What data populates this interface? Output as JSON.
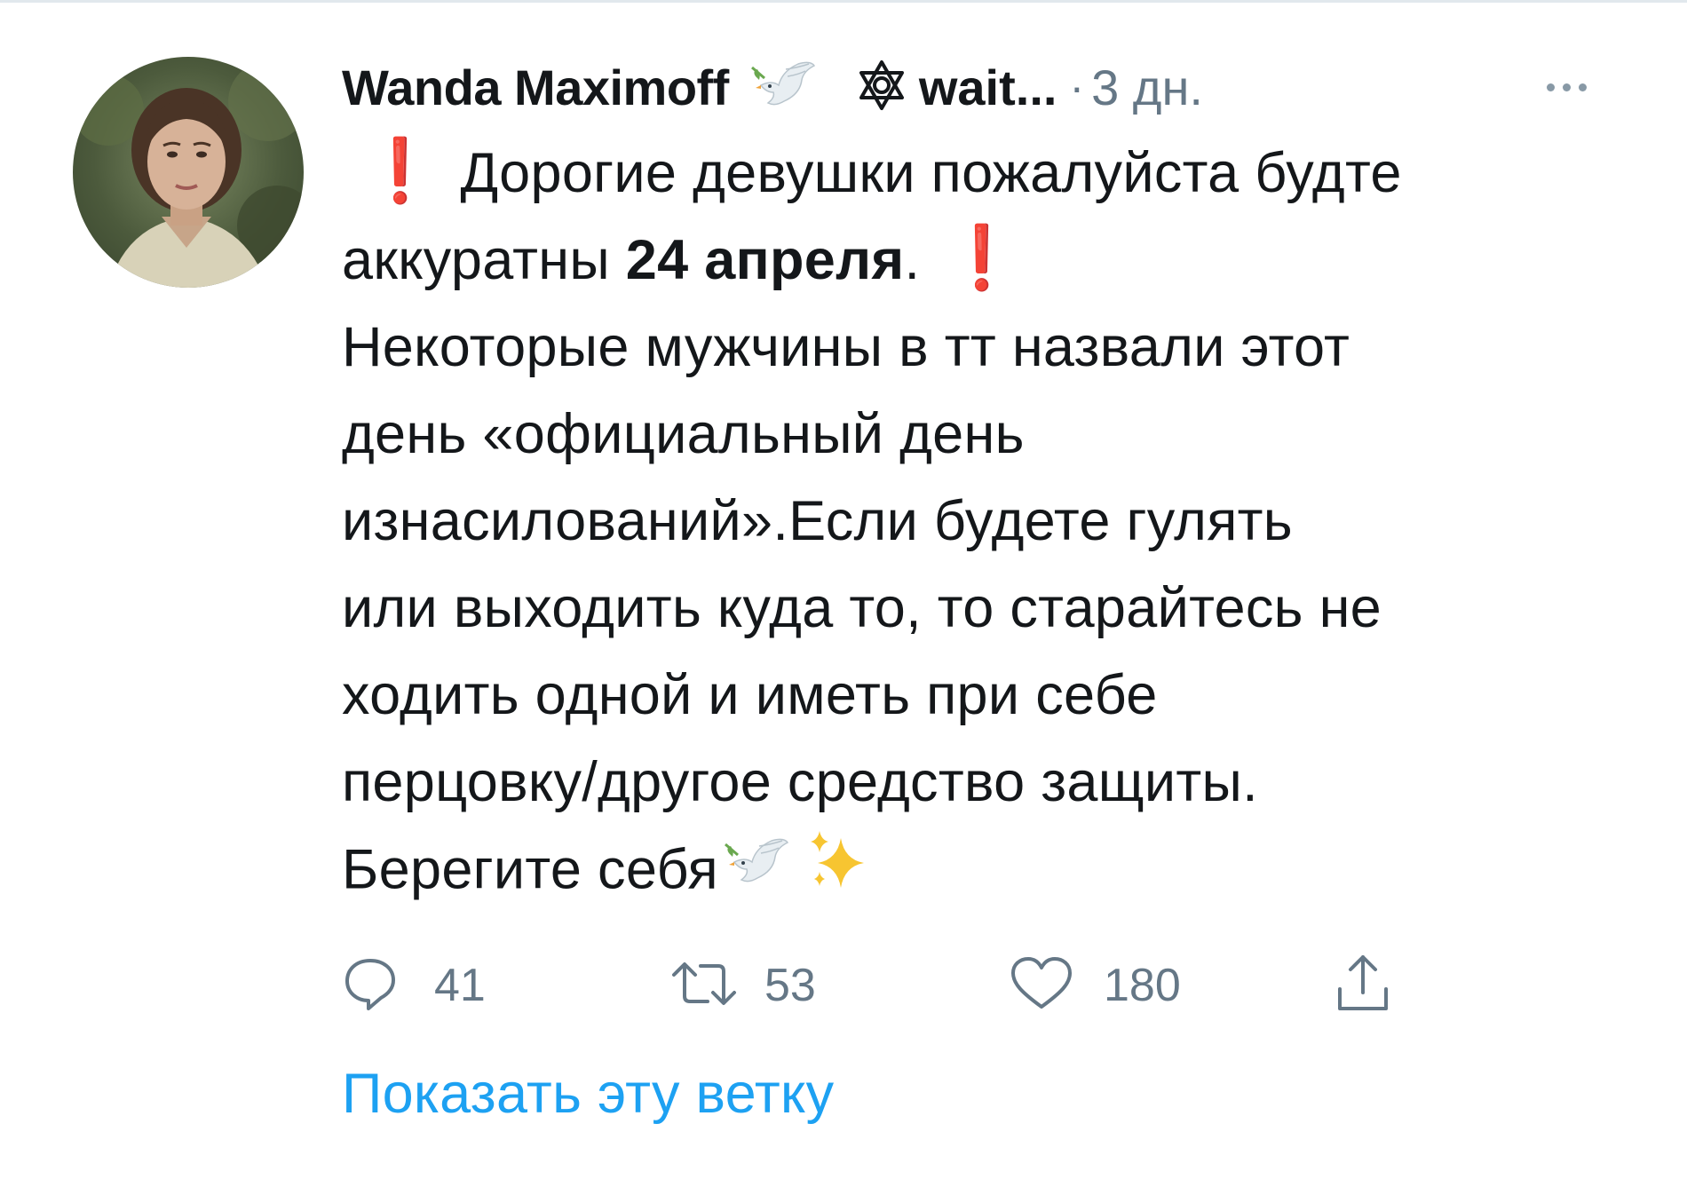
{
  "tweet": {
    "display_name": "Wanda Maximoff",
    "handle": "wait...",
    "separator": "·",
    "timestamp": "3 дн.",
    "icons": {
      "name_emoji": "dove-icon",
      "badge": "star-of-david-icon",
      "more": "more-dots-icon"
    },
    "body": {
      "exclaim": "❗",
      "line1_text": "Дорогие девушки пожалуйста будте",
      "line2_prefix": "аккуратны ",
      "line2_bold": "24 апреля",
      "line2_suffix": ". ",
      "line3": "Некоторые мужчины в тт назвали этот",
      "line4": "день «официальный день",
      "line5": "изнасилований».Если будете гулять",
      "line6": "или выходить куда то, то старайтесь не",
      "line7": "ходить одной и иметь при себе",
      "line8": "перцовку/другое средство защиты.",
      "line9": "Берегите себя"
    },
    "actions": {
      "replies": "41",
      "retweets": "53",
      "likes": "180"
    },
    "show_thread": "Показать эту ветку",
    "colors": {
      "text": "#14171a",
      "secondary": "#657786",
      "link": "#1da1f2",
      "exclaim": "#e0202f"
    }
  }
}
